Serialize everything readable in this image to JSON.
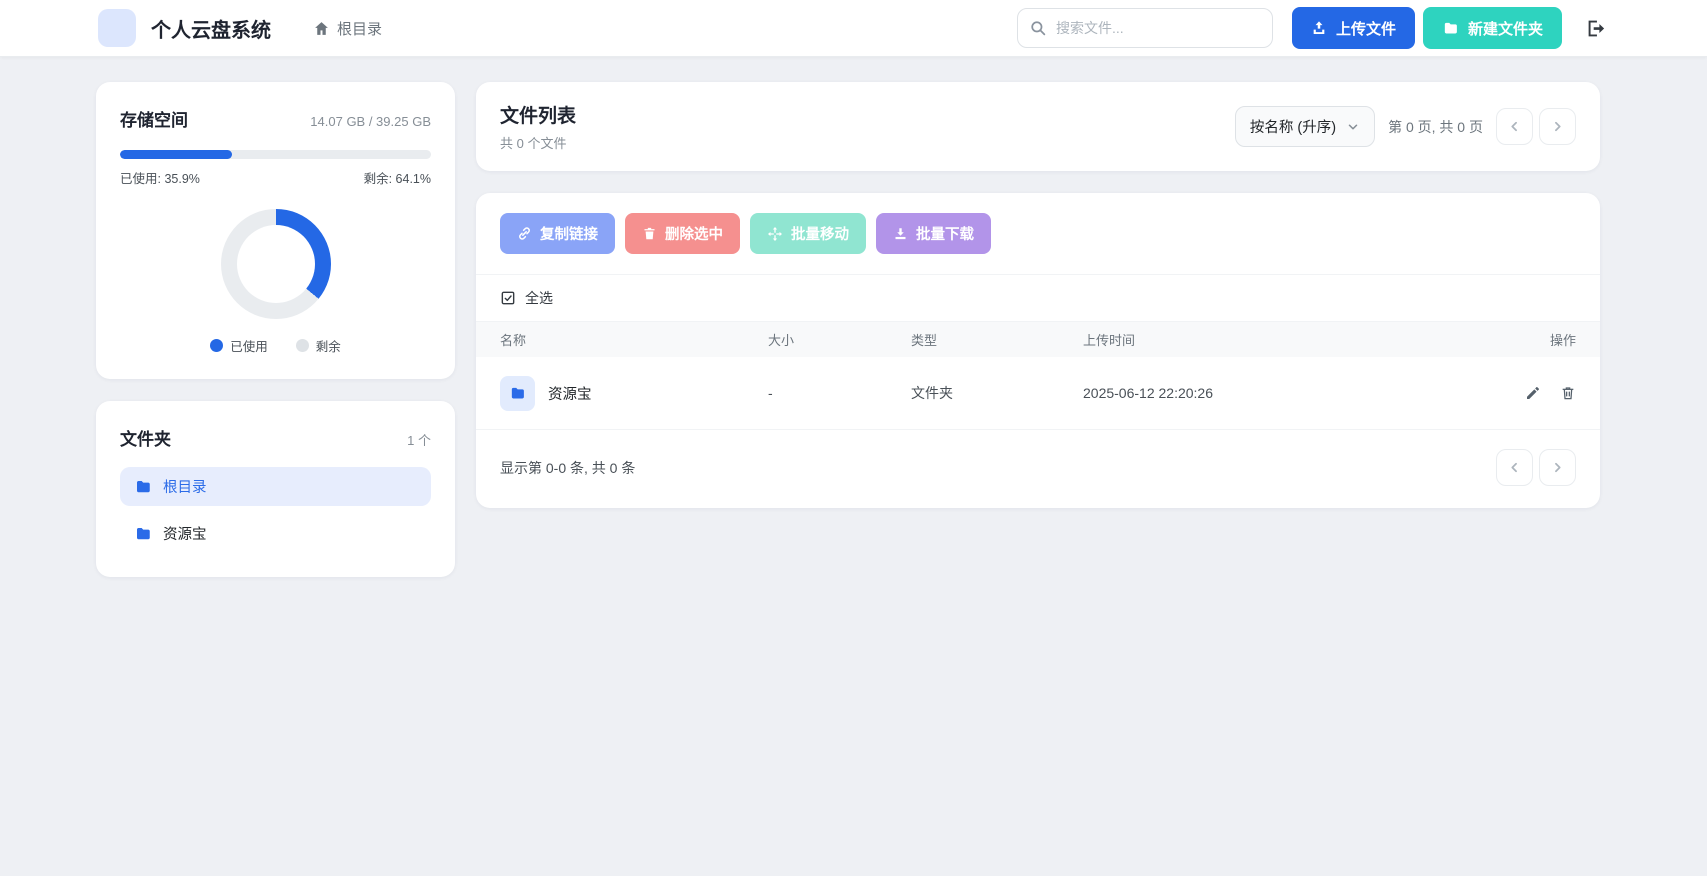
{
  "colors": {
    "primary": "#2468e5",
    "teal": "#2ed3bf",
    "track": "#e9ecef",
    "legend_free_dot": "#dee2e6"
  },
  "navbar": {
    "app_title": "个人云盘系统",
    "breadcrumb": "根目录",
    "search_placeholder": "搜索文件...",
    "upload_button": "上传文件",
    "new_folder_button": "新建文件夹"
  },
  "storage": {
    "title": "存储空间",
    "usage_text": "14.07 GB / 39.25 GB",
    "used_label": "已使用: 35.9%",
    "free_label": "剩余: 64.1%",
    "used_percent": 35.9,
    "legend_used": "已使用",
    "legend_free": "剩余"
  },
  "folders": {
    "title": "文件夹",
    "count": "1 个",
    "items": [
      {
        "label": "根目录"
      },
      {
        "label": "资源宝"
      }
    ]
  },
  "filelist": {
    "title": "文件列表",
    "subtitle": "共 0 个文件",
    "sort_value": "按名称 (升序)",
    "page_info": "第 0 页, 共 0 页",
    "select_all": "全选",
    "actions": [
      {
        "label": "复制链接",
        "color": "#8aa4f7"
      },
      {
        "label": "删除选中",
        "color": "#f5908f"
      },
      {
        "label": "批量移动",
        "color": "#90e5d1"
      },
      {
        "label": "批量下载",
        "color": "#b294e9"
      }
    ],
    "table": {
      "headers": [
        "名称",
        "大小",
        "类型",
        "上传时间",
        "操作"
      ],
      "rows": [
        {
          "name": "资源宝",
          "size": "-",
          "type": "文件夹",
          "uploaded": "2025-06-12 22:20:26"
        }
      ]
    },
    "footer_info": "显示第 0-0 条, 共 0 条"
  }
}
